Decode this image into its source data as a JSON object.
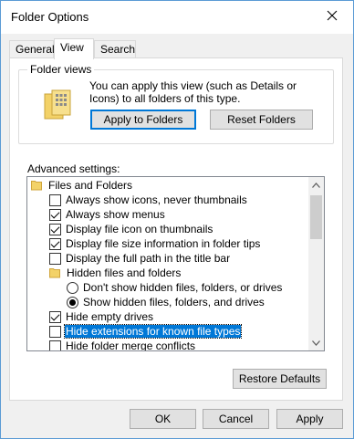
{
  "window": {
    "title": "Folder Options"
  },
  "tabs": [
    {
      "label": "General"
    },
    {
      "label": "View"
    },
    {
      "label": "Search"
    }
  ],
  "folder_views": {
    "legend": "Folder views",
    "description": "You can apply this view (such as Details or Icons) to all folders of this type.",
    "apply_label": "Apply to Folders",
    "reset_label": "Reset Folders"
  },
  "advanced": {
    "label": "Advanced settings:",
    "items": [
      {
        "type": "folder",
        "text": "Files and Folders"
      },
      {
        "type": "checkbox",
        "checked": false,
        "text": "Always show icons, never thumbnails"
      },
      {
        "type": "checkbox",
        "checked": true,
        "text": "Always show menus"
      },
      {
        "type": "checkbox",
        "checked": true,
        "text": "Display file icon on thumbnails"
      },
      {
        "type": "checkbox",
        "checked": true,
        "text": "Display file size information in folder tips"
      },
      {
        "type": "checkbox",
        "checked": false,
        "text": "Display the full path in the title bar"
      },
      {
        "type": "folder",
        "text": "Hidden files and folders"
      },
      {
        "type": "radio",
        "checked": false,
        "text": "Don't show hidden files, folders, or drives"
      },
      {
        "type": "radio",
        "checked": true,
        "text": "Show hidden files, folders, and drives"
      },
      {
        "type": "checkbox",
        "checked": true,
        "text": "Hide empty drives"
      },
      {
        "type": "checkbox",
        "checked": false,
        "selected": true,
        "text": "Hide extensions for known file types"
      },
      {
        "type": "checkbox",
        "checked": false,
        "text": "Hide folder merge conflicts"
      }
    ]
  },
  "restore_label": "Restore Defaults",
  "footer": {
    "ok": "OK",
    "cancel": "Cancel",
    "apply": "Apply"
  },
  "colors": {
    "accent": "#0078d7",
    "folder": "#f3d268"
  }
}
